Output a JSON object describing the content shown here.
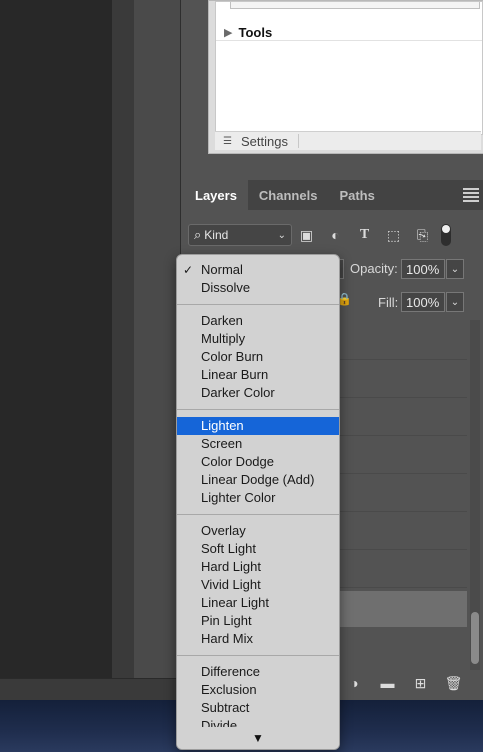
{
  "properties": {
    "tools_label": "Tools",
    "settings_label": "Settings"
  },
  "layers_panel": {
    "tabs": [
      {
        "label": "Layers",
        "active": true
      },
      {
        "label": "Channels",
        "active": false
      },
      {
        "label": "Paths",
        "active": false
      }
    ],
    "filter_kind": "Kind",
    "opacity_label": "Opacity:",
    "opacity_value": "100%",
    "fill_label": "Fill:",
    "fill_value": "100%"
  },
  "blend_menu": {
    "selected_checked": "Normal",
    "highlighted": "Lighten",
    "groups": [
      [
        "Normal",
        "Dissolve"
      ],
      [
        "Darken",
        "Multiply",
        "Color Burn",
        "Linear Burn",
        "Darker Color"
      ],
      [
        "Lighten",
        "Screen",
        "Color Dodge",
        "Linear Dodge (Add)",
        "Lighter Color"
      ],
      [
        "Overlay",
        "Soft Light",
        "Hard Light",
        "Vivid Light",
        "Linear Light",
        "Pin Light",
        "Hard Mix"
      ],
      [
        "Difference",
        "Exclusion",
        "Subtract",
        "Divide"
      ]
    ]
  },
  "colors": {
    "highlight": "#1565d8",
    "panel": "#535353",
    "menu_bg": "#d2d2d2"
  }
}
